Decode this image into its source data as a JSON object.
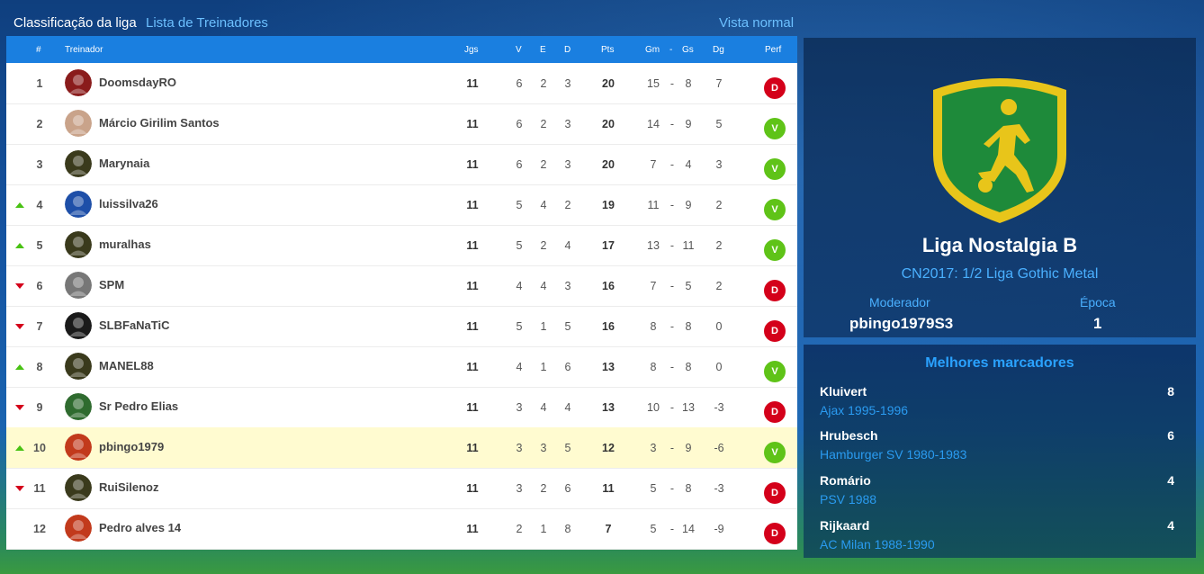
{
  "tabs": {
    "active": "Classificação da liga",
    "trainers": "Lista de Treinadores",
    "view": "Vista normal"
  },
  "table": {
    "headers": {
      "pos": "#",
      "trainer": "Treinador",
      "games": "Jgs",
      "wins": "V",
      "draws": "E",
      "losses": "D",
      "points": "Pts",
      "goals_for": "Gm",
      "goals_against": "Gs",
      "goal_diff": "Dg",
      "form": "Perf"
    },
    "rows": [
      {
        "pos": "1",
        "trend": "none",
        "name": "DoomsdayRO",
        "jgs": "11",
        "v": "6",
        "e": "2",
        "d": "3",
        "pts": "20",
        "gm": "15",
        "sep": "-",
        "gs": "8",
        "dg": "7",
        "perf": "D",
        "avatar_color": "#8a1c1c"
      },
      {
        "pos": "2",
        "trend": "none",
        "name": "Márcio Girilim Santos",
        "jgs": "11",
        "v": "6",
        "e": "2",
        "d": "3",
        "pts": "20",
        "gm": "14",
        "sep": "-",
        "gs": "9",
        "dg": "5",
        "perf": "V",
        "avatar_color": "#c9a38a"
      },
      {
        "pos": "3",
        "trend": "none",
        "name": "Marynaia",
        "jgs": "11",
        "v": "6",
        "e": "2",
        "d": "3",
        "pts": "20",
        "gm": "7",
        "sep": "-",
        "gs": "4",
        "dg": "3",
        "perf": "V",
        "avatar_color": "#3a3a1c"
      },
      {
        "pos": "4",
        "trend": "up",
        "name": "luissilva26",
        "jgs": "11",
        "v": "5",
        "e": "4",
        "d": "2",
        "pts": "19",
        "gm": "11",
        "sep": "-",
        "gs": "9",
        "dg": "2",
        "perf": "V",
        "avatar_color": "#1e4fa8"
      },
      {
        "pos": "5",
        "trend": "up",
        "name": "muralhas",
        "jgs": "11",
        "v": "5",
        "e": "2",
        "d": "4",
        "pts": "17",
        "gm": "13",
        "sep": "-",
        "gs": "11",
        "dg": "2",
        "perf": "V",
        "avatar_color": "#3a3a1c"
      },
      {
        "pos": "6",
        "trend": "down",
        "name": "SPM",
        "jgs": "11",
        "v": "4",
        "e": "4",
        "d": "3",
        "pts": "16",
        "gm": "7",
        "sep": "-",
        "gs": "5",
        "dg": "2",
        "perf": "D",
        "avatar_color": "#777777"
      },
      {
        "pos": "7",
        "trend": "down",
        "name": "SLBFaNaTiC",
        "jgs": "11",
        "v": "5",
        "e": "1",
        "d": "5",
        "pts": "16",
        "gm": "8",
        "sep": "-",
        "gs": "8",
        "dg": "0",
        "perf": "D",
        "avatar_color": "#1a1a1a"
      },
      {
        "pos": "8",
        "trend": "up",
        "name": "MANEL88",
        "jgs": "11",
        "v": "4",
        "e": "1",
        "d": "6",
        "pts": "13",
        "gm": "8",
        "sep": "-",
        "gs": "8",
        "dg": "0",
        "perf": "V",
        "avatar_color": "#3a3a1c"
      },
      {
        "pos": "9",
        "trend": "down",
        "name": "Sr Pedro Elias",
        "jgs": "11",
        "v": "3",
        "e": "4",
        "d": "4",
        "pts": "13",
        "gm": "10",
        "sep": "-",
        "gs": "13",
        "dg": "-3",
        "perf": "D",
        "avatar_color": "#2f6b2f"
      },
      {
        "pos": "10",
        "trend": "up",
        "name": "pbingo1979",
        "jgs": "11",
        "v": "3",
        "e": "3",
        "d": "5",
        "pts": "12",
        "gm": "3",
        "sep": "-",
        "gs": "9",
        "dg": "-6",
        "perf": "V",
        "avatar_color": "#c23a1c",
        "highlight": true
      },
      {
        "pos": "11",
        "trend": "down",
        "name": "RuiSilenoz",
        "jgs": "11",
        "v": "3",
        "e": "2",
        "d": "6",
        "pts": "11",
        "gm": "5",
        "sep": "-",
        "gs": "8",
        "dg": "-3",
        "perf": "D",
        "avatar_color": "#3a3a1c"
      },
      {
        "pos": "12",
        "trend": "none",
        "name": "Pedro alves 14",
        "jgs": "11",
        "v": "2",
        "e": "1",
        "d": "8",
        "pts": "7",
        "gm": "5",
        "sep": "-",
        "gs": "14",
        "dg": "-9",
        "perf": "D",
        "avatar_color": "#c23a1c"
      }
    ]
  },
  "league": {
    "name": "Liga Nostalgia B",
    "subtitle": "CN2017: 1/2 Liga Gothic Metal",
    "moderator_label": "Moderador",
    "moderator": "pbingo1979S3",
    "season_label": "Época",
    "season": "1",
    "crest_color": "#1e8a3a",
    "crest_border": "#e8c51a"
  },
  "scorers": {
    "title": "Melhores marcadores",
    "items": [
      {
        "name": "Kluivert",
        "club": "Ajax 1995-1996",
        "goals": "8"
      },
      {
        "name": "Hrubesch",
        "club": "Hamburger SV 1980-1983",
        "goals": "6"
      },
      {
        "name": "Romário",
        "club": "PSV 1988",
        "goals": "4"
      },
      {
        "name": "Rijkaard",
        "club": "AC Milan 1988-1990",
        "goals": "4"
      }
    ]
  }
}
